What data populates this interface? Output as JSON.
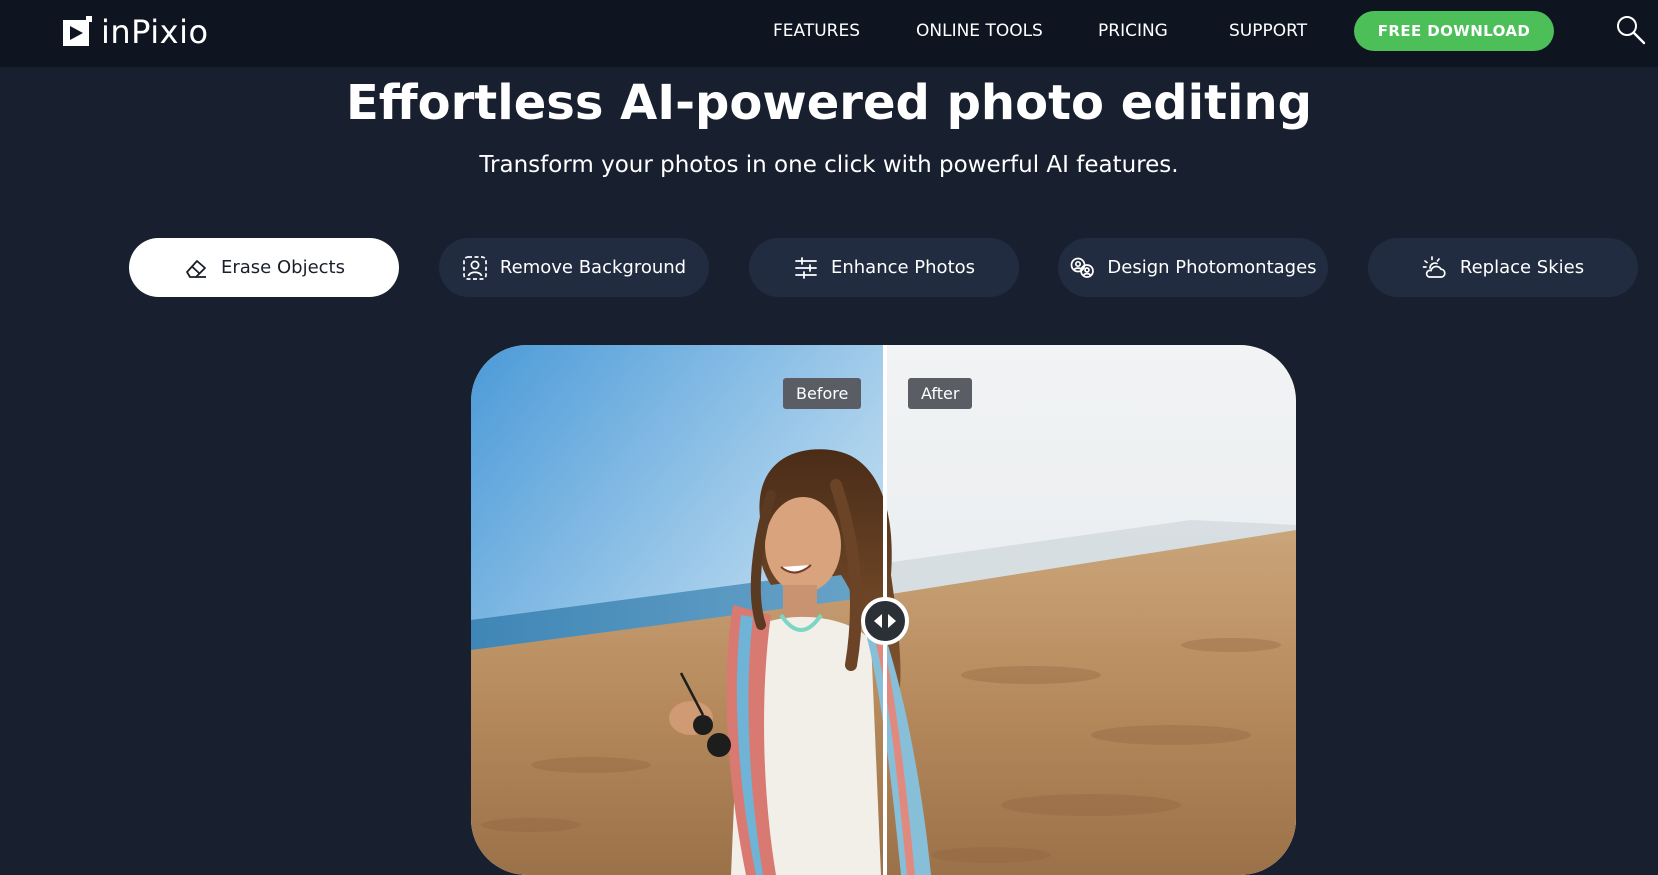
{
  "header": {
    "logo_text": "inPixio",
    "nav": [
      "FEATURES",
      "ONLINE TOOLS",
      "PRICING",
      "SUPPORT"
    ],
    "download_label": "FREE DOWNLOAD",
    "search_icon": "search-icon"
  },
  "hero": {
    "title": "Effortless AI-powered photo editing",
    "subtitle": "Transform your photos in one click with powerful AI features."
  },
  "tabs": [
    {
      "label": "Erase Objects",
      "icon": "eraser-icon",
      "active": true
    },
    {
      "label": "Remove Background",
      "icon": "portrait-frame-icon",
      "active": false
    },
    {
      "label": "Enhance Photos",
      "icon": "sliders-icon",
      "active": false
    },
    {
      "label": "Design Photomontages",
      "icon": "photomontage-icon",
      "active": false
    },
    {
      "label": "Replace Skies",
      "icon": "sun-cloud-icon",
      "active": false
    }
  ],
  "comparison": {
    "before_label": "Before",
    "after_label": "After",
    "handle_icon": "drag-arrows-icon"
  },
  "colors": {
    "page_bg": "#18202f",
    "header_bg": "#0e1420",
    "download_green": "#4cbf58",
    "tab_bg": "#212c40",
    "tab_active_bg": "#ffffff"
  }
}
